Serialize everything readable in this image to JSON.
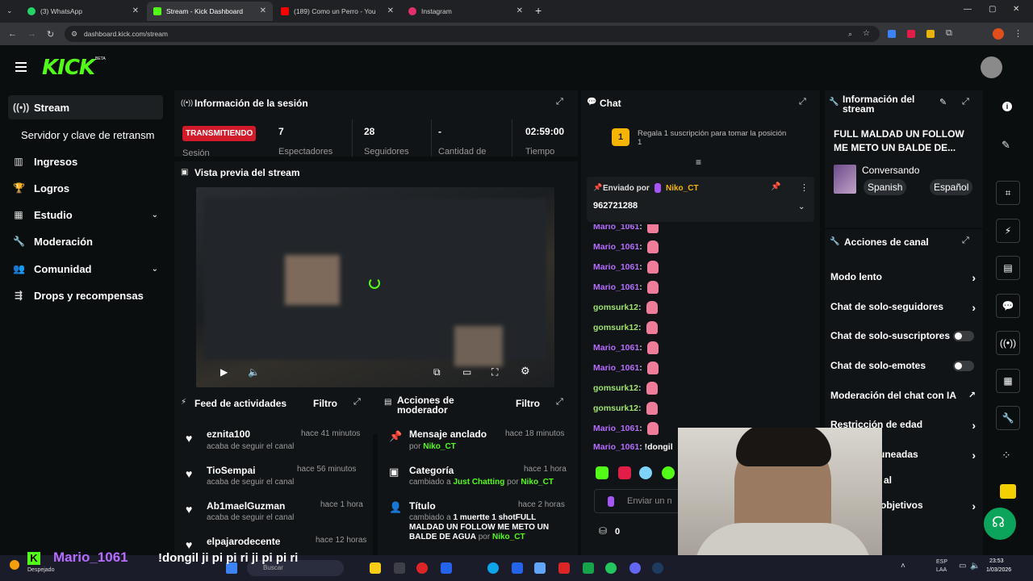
{
  "browser": {
    "tabs": [
      {
        "label": "(3) WhatsApp",
        "color": "#25d366"
      },
      {
        "label": "Stream - Kick Dashboard",
        "color": "#53fc18"
      },
      {
        "label": "(189) Como un Perro - You",
        "color": "#ff0000"
      },
      {
        "label": "Instagram",
        "color": "#e1306c"
      }
    ],
    "url": "dashboard.kick.com/stream"
  },
  "logo": "KICK",
  "logo_badge": "BETA",
  "sidebar": {
    "items": [
      {
        "label": "Stream",
        "icon": "broadcast-icon"
      },
      {
        "label": "Servidor y clave de retransm",
        "icon": ""
      },
      {
        "label": "Ingresos",
        "icon": "chart-icon"
      },
      {
        "label": "Logros",
        "icon": "trophy-icon"
      },
      {
        "label": "Estudio",
        "icon": "grid-icon"
      },
      {
        "label": "Moderación",
        "icon": "wrench-icon"
      },
      {
        "label": "Comunidad",
        "icon": "users-icon"
      },
      {
        "label": "Drops y recompensas",
        "icon": "gift-icon"
      }
    ]
  },
  "session": {
    "title": "Información de la sesión",
    "status": "TRANSMITIENDO",
    "stats": [
      {
        "value": "7",
        "label": "Espectadores"
      },
      {
        "value": "28",
        "label": "Seguidores"
      },
      {
        "value": "-",
        "label": "Cantidad de"
      },
      {
        "value": "02:59:00",
        "label": "Tiempo"
      }
    ],
    "first_label": "Sesión"
  },
  "preview": {
    "title": "Vista previa del stream"
  },
  "activity": {
    "title": "Feed de actividades",
    "filter": "Filtro",
    "items": [
      {
        "user": "eznita100",
        "time": "hace 41 minutos",
        "desc": "acaba de seguir el canal"
      },
      {
        "user": "TioSempai",
        "time": "hace 56 minutos",
        "desc": "acaba de seguir el canal"
      },
      {
        "user": "Ab1maelGuzman",
        "time": "hace 1 hora",
        "desc": "acaba de seguir el canal"
      },
      {
        "user": "elpajarodecente",
        "time": "hace 12 horas",
        "desc": ""
      }
    ]
  },
  "modactions": {
    "title_line1": "Acciones de",
    "title_line2": "moderador",
    "filter": "Filtro",
    "items": [
      {
        "title": "Mensaje anclado",
        "time": "hace 18 minutos",
        "line": "por",
        "by": "Niko_CT"
      },
      {
        "title": "Categoría",
        "time": "hace 1 hora",
        "line": "cambiado a",
        "target": "Just Chatting",
        "by_word": "por",
        "by": "Niko_CT"
      },
      {
        "title": "Título",
        "time": "hace 2 horas",
        "line": "cambiado a",
        "target": "1 muertte 1 shotFULL MALDAD UN FOLLOW ME METO UN BALDE DE AGUA",
        "by_word": "por",
        "by": "Niko_CT"
      }
    ]
  },
  "chat": {
    "title": "Chat",
    "promo": "Regala 1 suscripción para tomar la posición 1",
    "promo_rank": "1",
    "pinned_by_label": "Enviado por",
    "pinned_user": "Niko_CT",
    "pinned_message": "962721288",
    "messages": [
      {
        "user": "Mario_1061",
        "color": "purple"
      },
      {
        "user": "Mario_1061",
        "color": "purple"
      },
      {
        "user": "Mario_1061",
        "color": "purple"
      },
      {
        "user": "Mario_1061",
        "color": "purple"
      },
      {
        "user": "gomsurk12",
        "color": "green"
      },
      {
        "user": "gomsurk12",
        "color": "green"
      },
      {
        "user": "Mario_1061",
        "color": "purple"
      },
      {
        "user": "Mario_1061",
        "color": "purple"
      },
      {
        "user": "gomsurk12",
        "color": "green"
      },
      {
        "user": "gomsurk12",
        "color": "green"
      },
      {
        "user": "Mario_1061",
        "color": "purple"
      },
      {
        "user": "Mario_1061",
        "color": "purple"
      }
    ],
    "last_message_text": "!dongil",
    "input_placeholder": "Enviar un n",
    "points": "0"
  },
  "streaminfo": {
    "title_line1": "Información del",
    "title_line2": "stream",
    "stream_title": "FULL MALDAD UN FOLLOW ME METO UN BALDE DE...",
    "category": "Conversando",
    "tags": [
      "Spanish",
      "Español"
    ]
  },
  "channel_actions": {
    "title": "Acciones de canal",
    "rows": [
      {
        "label": "Modo lento",
        "control": "arrow"
      },
      {
        "label": "Chat de solo-seguidores",
        "control": "arrow"
      },
      {
        "label": "Chat de solo-suscriptores",
        "control": "toggle"
      },
      {
        "label": "Chat de solo-emotes",
        "control": "toggle"
      },
      {
        "label": "Moderación del chat con IA",
        "control": "external"
      },
      {
        "label": "Restricción de edad",
        "control": "arrow"
      },
      {
        "label": "uneadas",
        "control": "arrow"
      },
      {
        "label": "al",
        "control": ""
      },
      {
        "label": "objetivos",
        "control": "arrow"
      }
    ]
  },
  "overlay": {
    "user": "Mario_1061",
    "message": "!dongil ji pi pi ri ji pi pi ri"
  },
  "taskbar": {
    "weather": "Despejado",
    "search": "Buscar",
    "lang": "ESP",
    "lang2": "LAA",
    "time": "23:53",
    "date": "1/03/2026"
  }
}
